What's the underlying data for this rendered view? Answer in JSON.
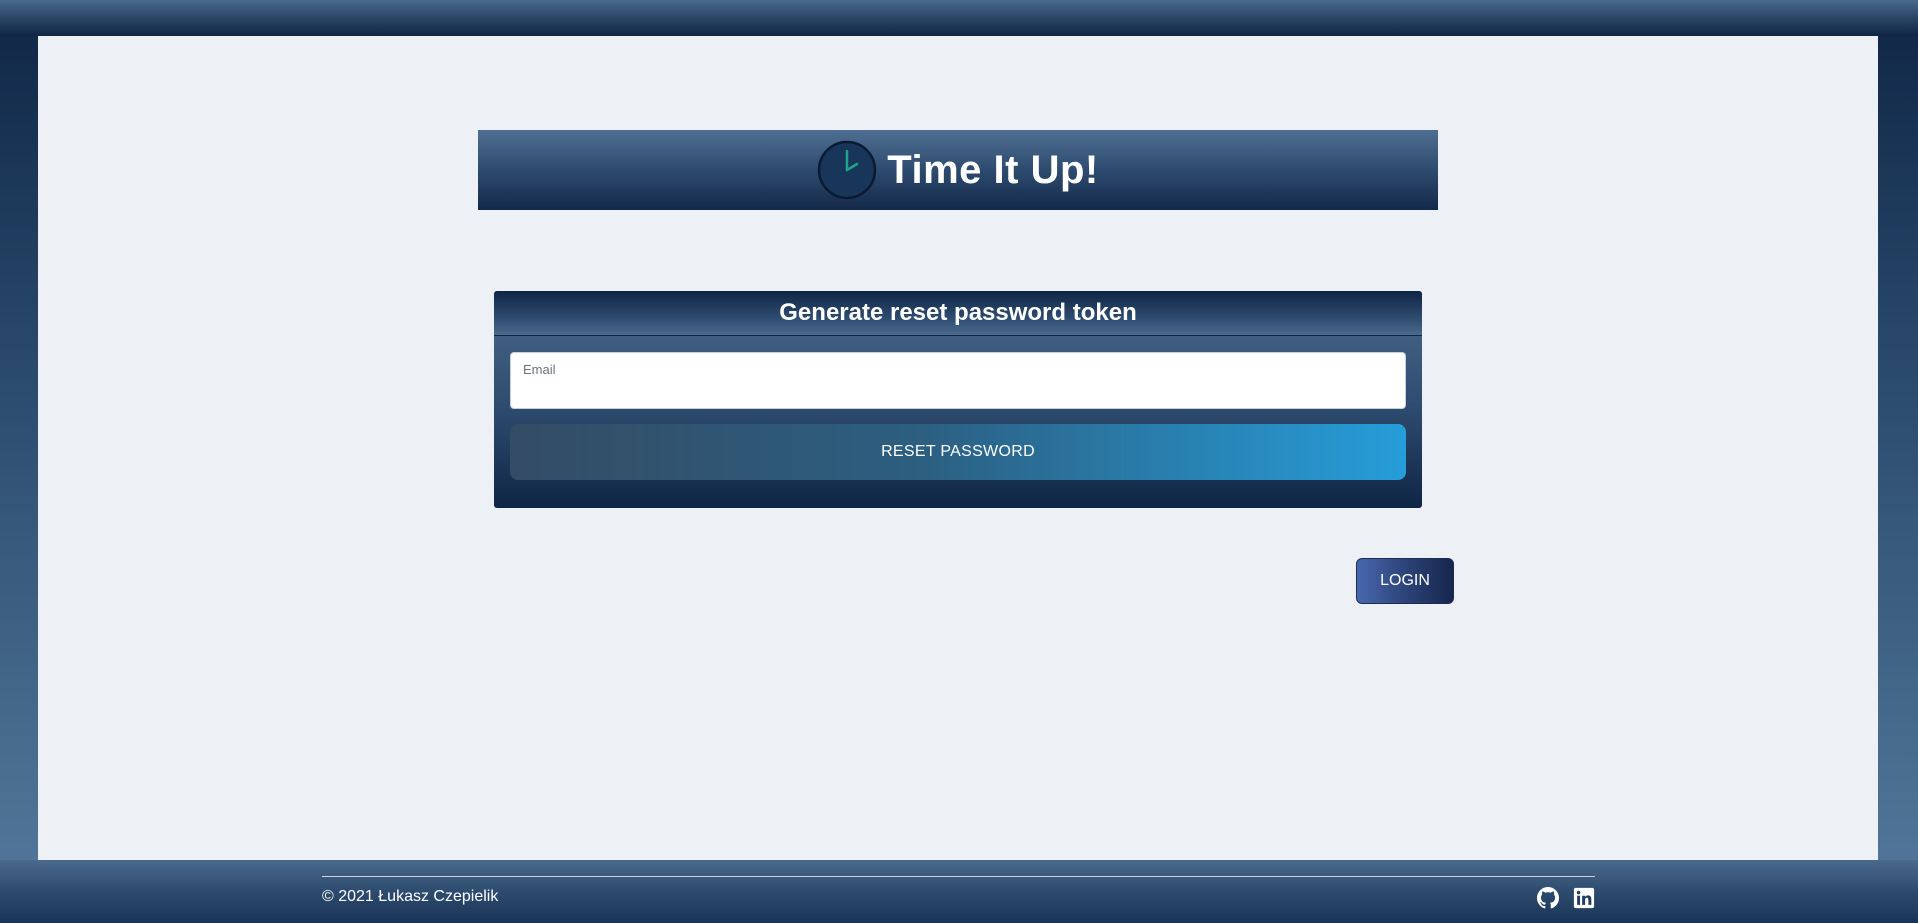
{
  "header": {
    "title": "Time It Up!",
    "logo_icon": "clock-icon"
  },
  "card": {
    "title": "Generate reset password token",
    "email_field": {
      "label": "Email",
      "value": "",
      "placeholder": ""
    },
    "reset_button_label": "RESET PASSWORD"
  },
  "login_button_label": "LOGIN",
  "footer": {
    "copyright": "© 2021 Łukasz Czepielik",
    "icons": [
      "github-icon",
      "linkedin-icon"
    ]
  },
  "colors": {
    "frame_dark": "#0f2545",
    "page_background": "#edf0f4",
    "clock_hand": "#1ea58a",
    "reset_button_end": "#269dd9",
    "login_button_start": "#4767ad"
  }
}
